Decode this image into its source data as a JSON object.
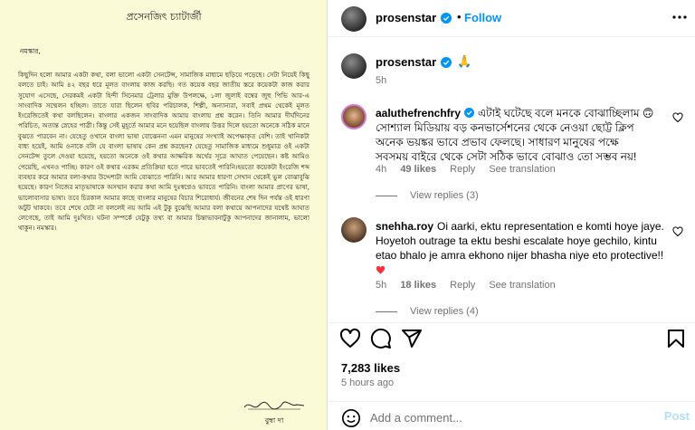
{
  "letter": {
    "heading": "প্রসেনজিৎ চ্যাটার্জী",
    "greeting": "নমস্কার,",
    "body": "কিছুদিন হলো আমার একটা কথা, বলা ভালো একটা সেনটেন্স, সামাজিক মাধ্যমে ছড়িয়ে পড়েছে। সেটা নিয়েই কিছু বলতে চাই। আমি ৪২ বছর ধরে মূলত বাংলায় কাজ করছি। গত কয়েক বছর জাতীয় স্তরে কয়েকটা কাজ করার সুযোগ এসেছে, সেরকমই একটা হিন্দী সিনেমার ট্রেলার মুক্তি উপলক্ষে, ১লা জুলাই বম্বের জুহু পিভি আর-এ সাংবাদিক সম্মেলন হচ্ছিল। তাতে যারা ছিলেন ছবির পরিচালক, শিল্পী, অন্যান্যরা, সবাই প্রথম থেকেই মূলত ইংরেজিতেই কথা বলছিলেন। বাংলার একজন সাংবাদিক আমায় বাংলায় প্রশ্ন করেন। তিনি আমার দীর্ঘদিনের পরিচিত, অত্যন্ত স্নেহের পাত্রী। কিন্তু সেই মুহূর্তে আমার মনে হয়েছিল বাংলায় উত্তর দিলে হয়তো অনেকে সঠিক মানে বুঝতে পারবেন না। যেহেতু ওখানে বাংলা ভাষা বোঝেননা এমন মানুষের সংখ্যাই অপেক্ষাকৃত বেশি। তাই খানিকটা বাধ্য হয়েই, আমি ওনাকে বলি যে বাংলা ভাষায় কেন প্রশ্ন করছেন? যেহেতু সামাজিক মাধ্যমে শুধুমাত্র ওই একটা সেনটেন্স তুলে দেওয়া হয়েছে, হয়তো অনেকে ওই কথার আক্ষরিক অর্থের সূত্রে আঘাত পেয়েছেন। কষ্ট আমিও পেয়েছি, এখনও পাচ্ছি। কারণ ওই কথার এরকম প্রতিক্রিয়া হতে পারে ভাবতেই পারিনি।হয়তো কয়েকটা ইংরেজি শব্দ ব্যবহার করে আমার বলা-কথার উদ্দেশ্যটা আমি বোঝাতে পারিনি। আর আমার ধারণা সেখান থেকেই ভুল বোঝাবুঝি হয়েছে। কারণ নিজের মাতৃভাষাকে অসম্মান করার কথা আমি দুঃস্বপ্নেও ভাবতে পারিনি। বাংলা আমার প্রাণের ভাষা, ভালোবাসার ভাষা। তবে চিরকাল আমার কাছে বাংলার মানুষের বিচার শিরোধার্য। জীবনের শেষ দিন পর্যন্ত ওই ধারণা অটুট থাকবে। তবে শেষে যেটা না বললেই নয় আমি এই টুকু বুঝেছি আমার বলা কথায়ে আপনাদের যথেষ্ট আঘাত লেগেছে, তাই আমি দুঃখিত। ঘটনা সম্পর্কে যেটুকু তথ্য বা আমার চিন্তাভাবনাটুকু আপনাদের জানালাম, ভালো থাকুন। নমস্কার।",
    "signature_name": "বুম্বা দা"
  },
  "header": {
    "username": "prosenstar",
    "separator": "•",
    "follow_label": "Follow"
  },
  "caption": {
    "username": "prosenstar",
    "text": "🙏",
    "time": "5h"
  },
  "comments": [
    {
      "username": "aaluthefrenchfry",
      "text_lines": [
        "এটাই ঘটেছে বলে মনকে বোঝাচ্ছিলাম 🙃",
        "সোশ্যাল মিডিয়ায় বড় কনভার্সেশনের থেকে নেওয়া ছোট্ট ক্লিপ",
        "অনেক ভয়ঙ্কর ভাবে প্রভাব ফেলছে। সাধারণ মানুষের পক্ষে",
        "সবসময় বাইরে থেকে সেটা সঠিক ভাবে বোঝাও তো সম্ভব নয়!"
      ],
      "time": "4h",
      "likes": "49 likes",
      "reply_label": "Reply",
      "translation_label": "See translation",
      "view_replies": "View replies (3)"
    },
    {
      "username": "snehha.roy",
      "text_lines": [
        "Oi aarki, ektu representation e komti hoye jaye.",
        "Hoyetoh outrage ta ektu beshi escalate hoye gechilo, kintu",
        "etao bhalo je amra ekhono nijer bhasha niye eto protective!!"
      ],
      "time": "5h",
      "likes": "18 likes",
      "reply_label": "Reply",
      "translation_label": "See translation",
      "view_replies": "View replies (4)"
    }
  ],
  "stats": {
    "likes": "7,283 likes",
    "time_ago": "5 hours ago"
  },
  "add_comment": {
    "placeholder": "Add a comment...",
    "post_label": "Post"
  },
  "colors": {
    "accent": "#0095f6",
    "verified": "#0095f6",
    "paper": "#fbfad7",
    "heart": "#ff3040"
  },
  "icons": [
    "verified-badge-icon",
    "more-options-icon",
    "heart-icon",
    "comment-icon",
    "share-icon",
    "bookmark-icon",
    "emoji-icon",
    "red-heart-emoji-icon"
  ]
}
